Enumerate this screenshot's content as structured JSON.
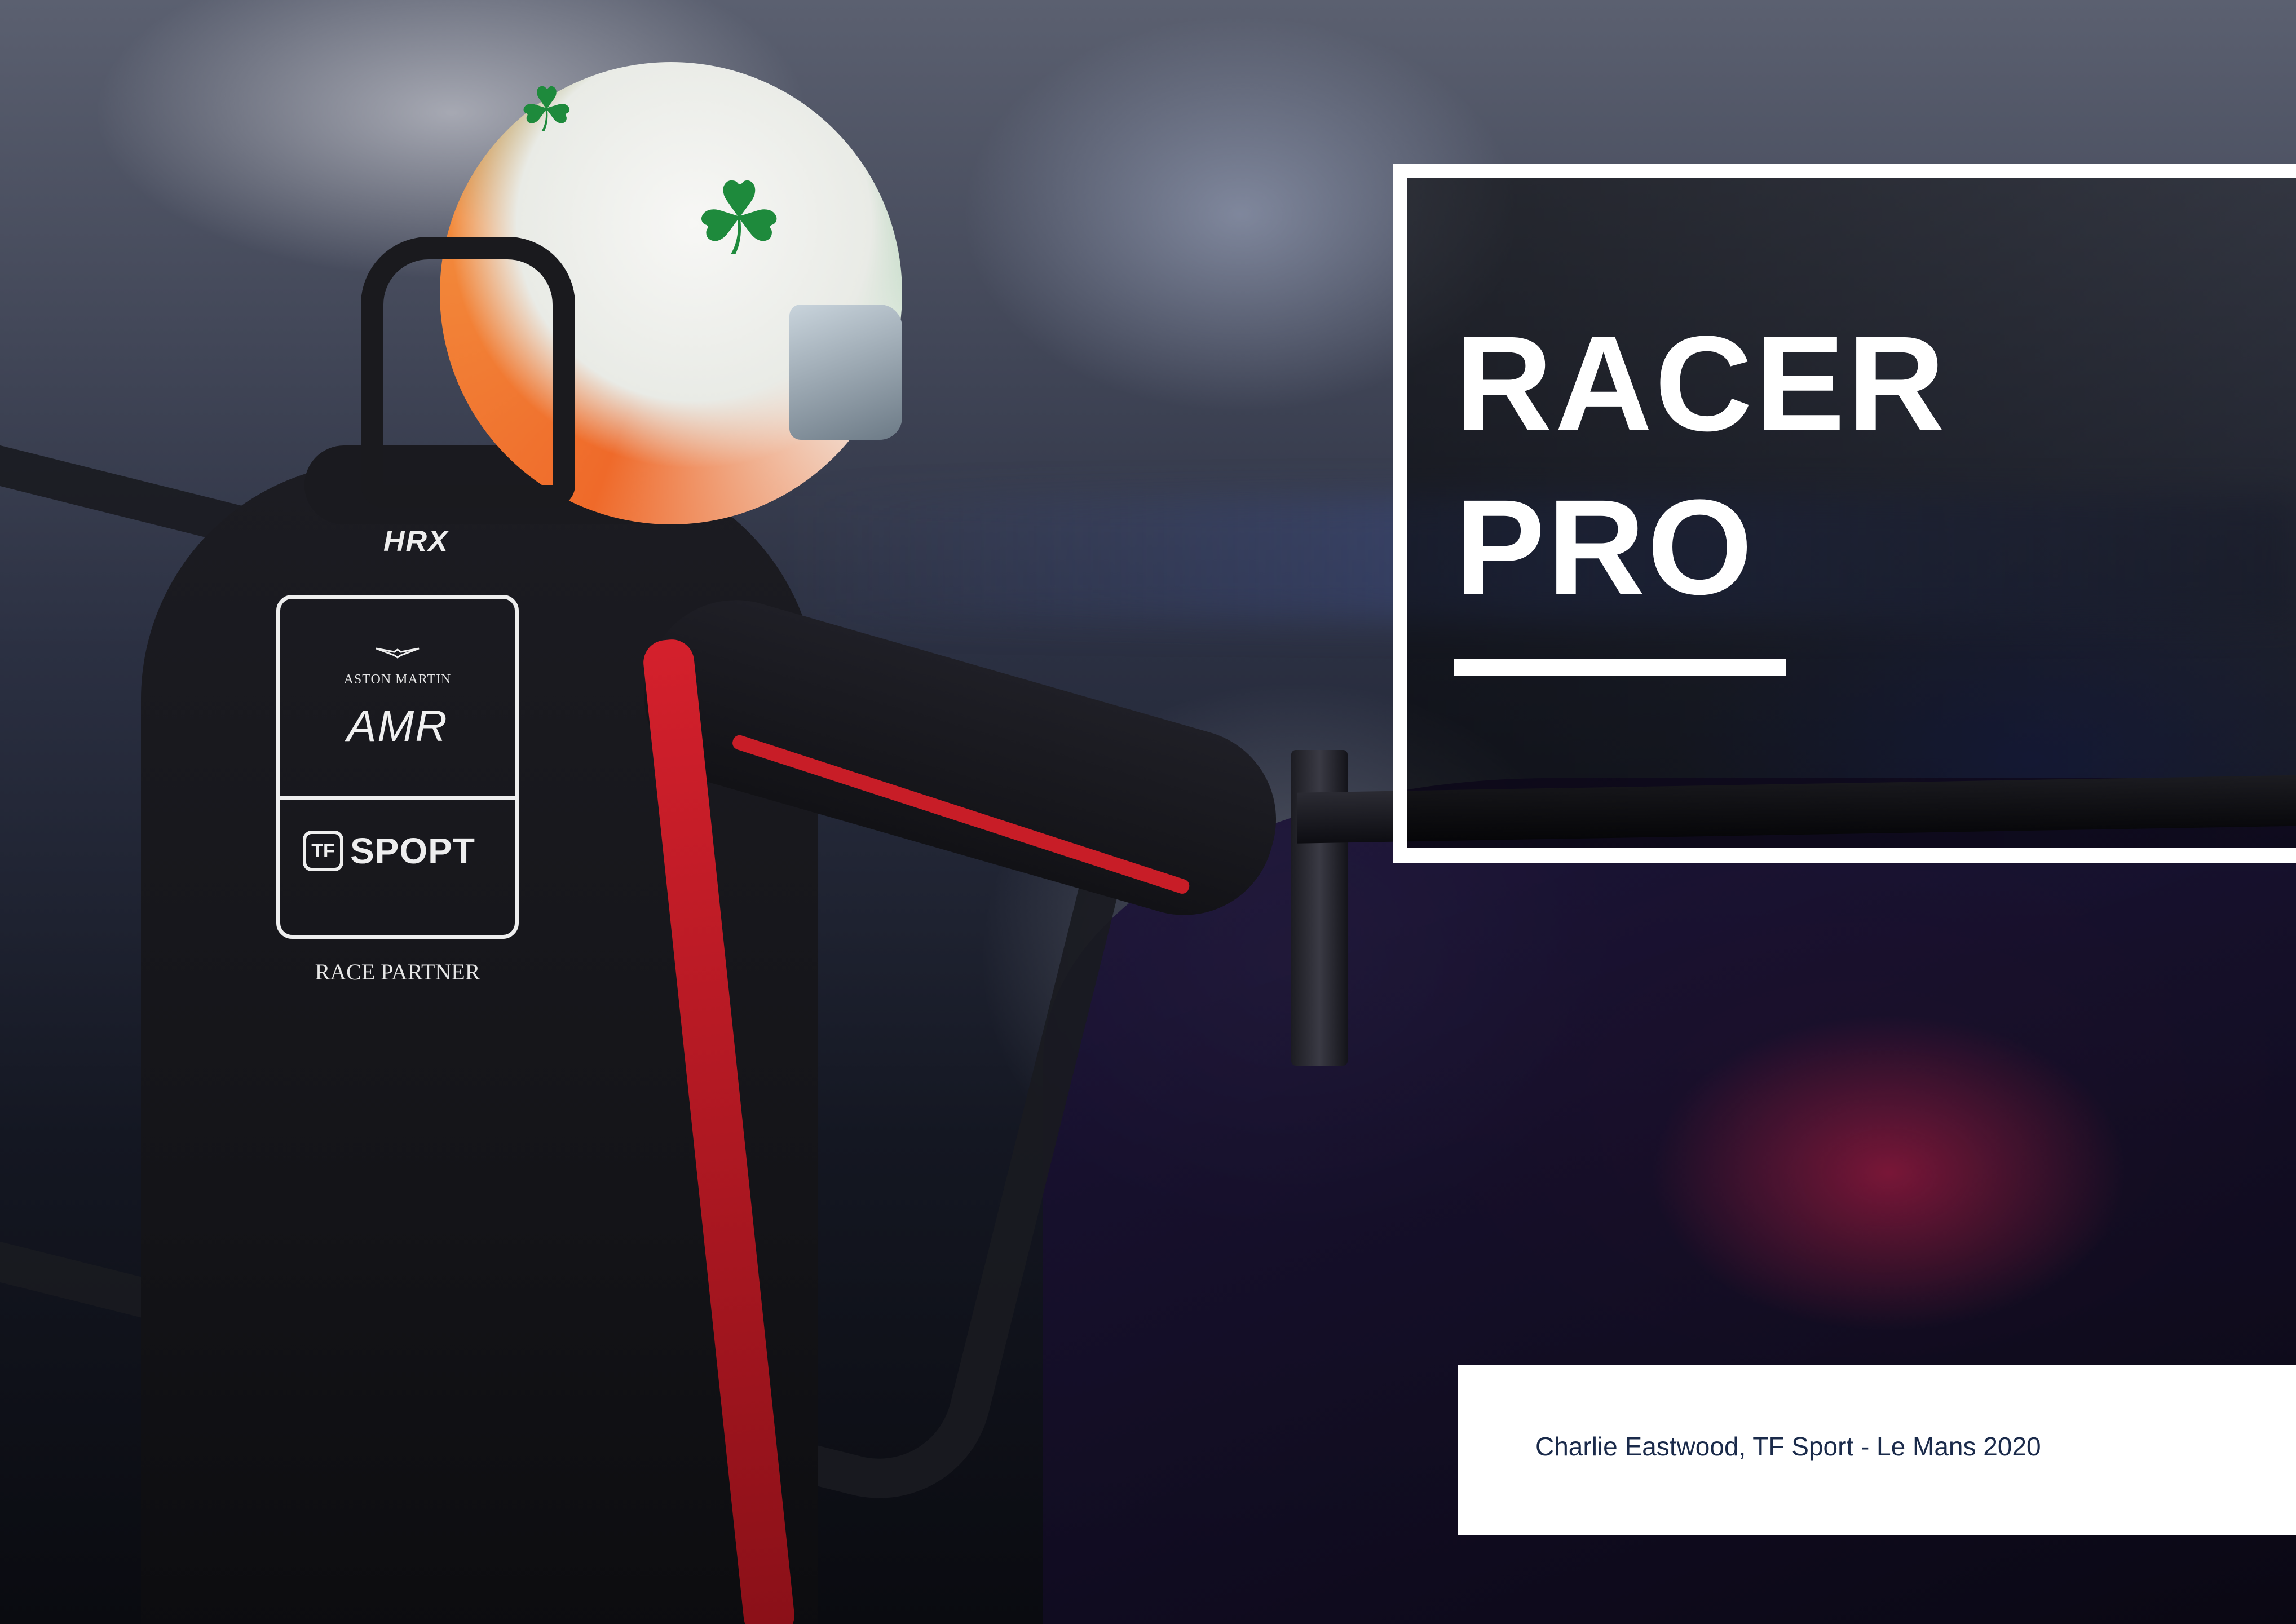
{
  "title": {
    "line1": "RACER",
    "line2": "PRO"
  },
  "caption": {
    "text": "Charlie Eastwood, TF Sport - Le Mans 2020"
  },
  "suit": {
    "collar_logo": "HRX",
    "patch_brand": "ASTON MARTIN",
    "patch_logo": "AMR",
    "tf_badge": "TF",
    "tf_word": "SPOPT",
    "race_partner": "RACE PARTNER"
  },
  "colors": {
    "frame": "#ffffff",
    "caption_text": "#1a2a4a",
    "accent_red": "#d4202c"
  }
}
